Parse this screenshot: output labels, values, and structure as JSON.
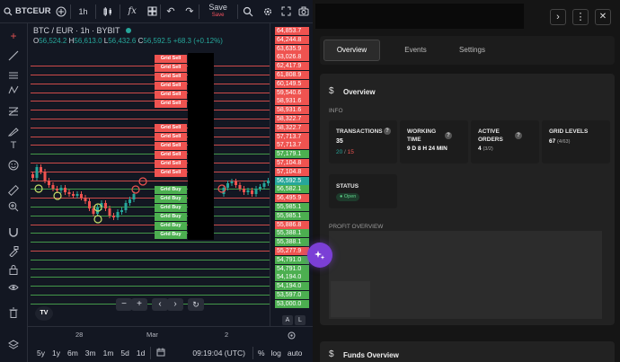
{
  "toolbar": {
    "symbol": "BTCEUR",
    "interval": "1h",
    "indicator_glyph": "fx",
    "save_label": "Save",
    "save_sub": "Save"
  },
  "legend": {
    "title": "BTC / EUR · 1h · BYBIT",
    "o_label": "O",
    "o_val": "56,524.2",
    "h_label": "H",
    "h_val": "56,613.0",
    "l_label": "L",
    "l_val": "56,432.6",
    "c_label": "C",
    "c_val": "56,592.5",
    "change": "+68.3 (+0.12%)",
    "colors": {
      "up": "#26a69a",
      "down": "#ef5350"
    }
  },
  "price_axis": {
    "labels": [
      {
        "text": "64,853.7",
        "side": "sell"
      },
      {
        "text": "64,244.8",
        "side": "sell"
      },
      {
        "text": "63,635.9",
        "side": "sell"
      },
      {
        "text": "63,026.8",
        "side": "sell"
      },
      {
        "text": "62,417.9",
        "side": "sell"
      },
      {
        "text": "61,808.9",
        "side": "sell"
      },
      {
        "text": "60,149.5",
        "side": "sell"
      },
      {
        "text": "59,540.6",
        "side": "sell"
      },
      {
        "text": "58,931.6",
        "side": "sell"
      },
      {
        "text": "58,931.6",
        "side": "sell"
      },
      {
        "text": "58,322.7",
        "side": "sell"
      },
      {
        "text": "58,322.7",
        "side": "sell"
      },
      {
        "text": "57,713.7",
        "side": "sell"
      },
      {
        "text": "57,713.7",
        "side": "sell"
      },
      {
        "text": "57,179.1",
        "side": "buy"
      },
      {
        "text": "57,104.8",
        "side": "sell"
      },
      {
        "text": "57,104.8",
        "side": "sell"
      },
      {
        "text": "56,592.5",
        "side": "current"
      },
      {
        "text": "56,582.1",
        "side": "buy"
      },
      {
        "text": "56,495.9",
        "side": "sell"
      },
      {
        "text": "55,985.1",
        "side": "buy"
      },
      {
        "text": "55,985.1",
        "side": "buy"
      },
      {
        "text": "55,886.8",
        "side": "sell"
      },
      {
        "text": "55,388.1",
        "side": "buy"
      },
      {
        "text": "55,388.1",
        "side": "buy"
      },
      {
        "text": "55,277.9",
        "side": "sell"
      },
      {
        "text": "54,791.0",
        "side": "buy"
      },
      {
        "text": "54,791.0",
        "side": "buy"
      },
      {
        "text": "54,194.0",
        "side": "buy"
      },
      {
        "text": "54,194.0",
        "side": "buy"
      },
      {
        "text": "53,597.0",
        "side": "buy"
      },
      {
        "text": "53,000.0",
        "side": "buy"
      }
    ]
  },
  "grid_boxes": [
    {
      "label": "Grid Sell",
      "side": "sell"
    },
    {
      "label": "Grid Sell",
      "side": "sell"
    },
    {
      "label": "Grid Sell",
      "side": "sell"
    },
    {
      "label": "Grid Sell",
      "side": "sell"
    },
    {
      "label": "Grid Sell",
      "side": "sell"
    },
    {
      "label": "Grid Sell",
      "side": "sell"
    },
    {
      "label": "Grid Sell",
      "side": "sell"
    },
    {
      "label": "Grid Sell",
      "side": "sell"
    },
    {
      "label": "Grid Sell",
      "side": "sell"
    },
    {
      "label": "Grid Sell",
      "side": "sell"
    },
    {
      "label": "Grid Sell",
      "side": "sell"
    },
    {
      "label": "Grid Sell",
      "side": "sell"
    },
    {
      "label": "Grid Buy",
      "side": "buy"
    },
    {
      "label": "Grid Buy",
      "side": "buy"
    },
    {
      "label": "Grid Buy",
      "side": "buy"
    },
    {
      "label": "Grid Buy",
      "side": "buy"
    },
    {
      "label": "Grid Buy",
      "side": "buy"
    },
    {
      "label": "Grid Buy",
      "side": "buy"
    }
  ],
  "time_axis": {
    "ticks": [
      "28",
      "Mar",
      "2"
    ]
  },
  "range_bar": {
    "ranges": [
      "5y",
      "1y",
      "6m",
      "3m",
      "1m",
      "5d",
      "1d"
    ],
    "time": "09:19:04 (UTC)",
    "percent": "%",
    "log": "log",
    "auto": "auto"
  },
  "scale_buttons": {
    "a": "A",
    "l": "L"
  },
  "tv_logo": "TV",
  "panel": {
    "tabs": [
      {
        "label": "Overview",
        "active": true
      },
      {
        "label": "Events",
        "active": false
      },
      {
        "label": "Settings",
        "active": false
      }
    ],
    "overview_title": "Overview",
    "info_label": "INFO",
    "cards": [
      {
        "title": "TRANSACTIONS",
        "value": "35",
        "sub_green": "20",
        "sub_sep": " / ",
        "sub_red": "15"
      },
      {
        "title": "WORKING TIME",
        "value": "9 D 8 H 24 MIN"
      },
      {
        "title": "ACTIVE ORDERS",
        "value": "4",
        "value_sub": "(3/2)"
      },
      {
        "title": "GRID LEVELS",
        "value": "67",
        "value_sub": "(4/63)"
      }
    ],
    "status_title": "STATUS",
    "status_value": "Open",
    "profit_label": "PROFIT OVERVIEW",
    "funds_title": "Funds Overview"
  }
}
